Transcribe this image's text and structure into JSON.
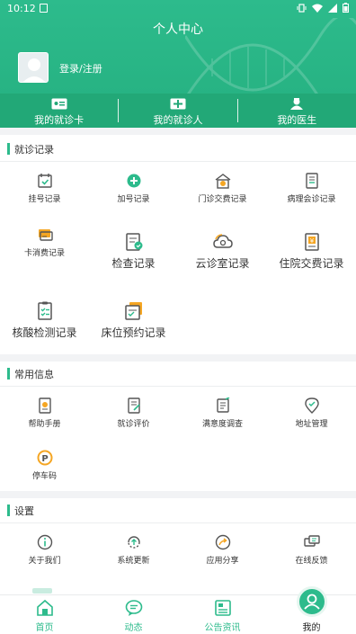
{
  "status_bar": {
    "time": "10:12"
  },
  "header": {
    "title": "个人中心",
    "login_label": "登录/注册",
    "quick_links": [
      {
        "label": "我的就诊卡",
        "icon": "card-icon"
      },
      {
        "label": "我的就诊人",
        "icon": "patient-icon"
      },
      {
        "label": "我的医生",
        "icon": "doctor-icon"
      }
    ]
  },
  "visit_records": {
    "title": "就诊记录",
    "items": [
      {
        "label": "挂号记录",
        "icon": "register-icon"
      },
      {
        "label": "加号记录",
        "icon": "add-number-icon"
      },
      {
        "label": "门诊交费记录",
        "icon": "outpatient-payment-icon"
      },
      {
        "label": "病理会诊记录",
        "icon": "pathology-icon"
      },
      {
        "label": "卡消费记录",
        "icon": "card-consumption-icon"
      },
      {
        "label": "检查记录",
        "icon": "exam-icon"
      },
      {
        "label": "云诊室记录",
        "icon": "cloud-clinic-icon"
      },
      {
        "label": "住院交费记录",
        "icon": "inpatient-payment-icon"
      },
      {
        "label": "核酸检测记录",
        "icon": "nucleic-test-icon"
      },
      {
        "label": "床位预约记录",
        "icon": "bed-reservation-icon"
      }
    ]
  },
  "common_info": {
    "title": "常用信息",
    "items": [
      {
        "label": "帮助手册",
        "icon": "help-manual-icon"
      },
      {
        "label": "就诊评价",
        "icon": "evaluation-icon"
      },
      {
        "label": "满意度调查",
        "icon": "survey-icon"
      },
      {
        "label": "地址管理",
        "icon": "address-icon"
      },
      {
        "label": "停车码",
        "icon": "parking-icon"
      }
    ]
  },
  "settings": {
    "title": "设置",
    "items": [
      {
        "label": "关于我们",
        "icon": "info-icon"
      },
      {
        "label": "系统更新",
        "icon": "update-icon"
      },
      {
        "label": "应用分享",
        "icon": "share-icon"
      },
      {
        "label": "在线反馈",
        "icon": "feedback-icon"
      }
    ]
  },
  "bottom_nav": [
    {
      "label": "首页",
      "icon": "home-icon"
    },
    {
      "label": "动态",
      "icon": "message-icon"
    },
    {
      "label": "公告资讯",
      "icon": "news-icon"
    },
    {
      "label": "我的",
      "icon": "user-icon",
      "active": true
    }
  ],
  "colors": {
    "brand": "#2dbb8c",
    "brand_dark": "#22a877",
    "accent_orange": "#f5a623"
  }
}
